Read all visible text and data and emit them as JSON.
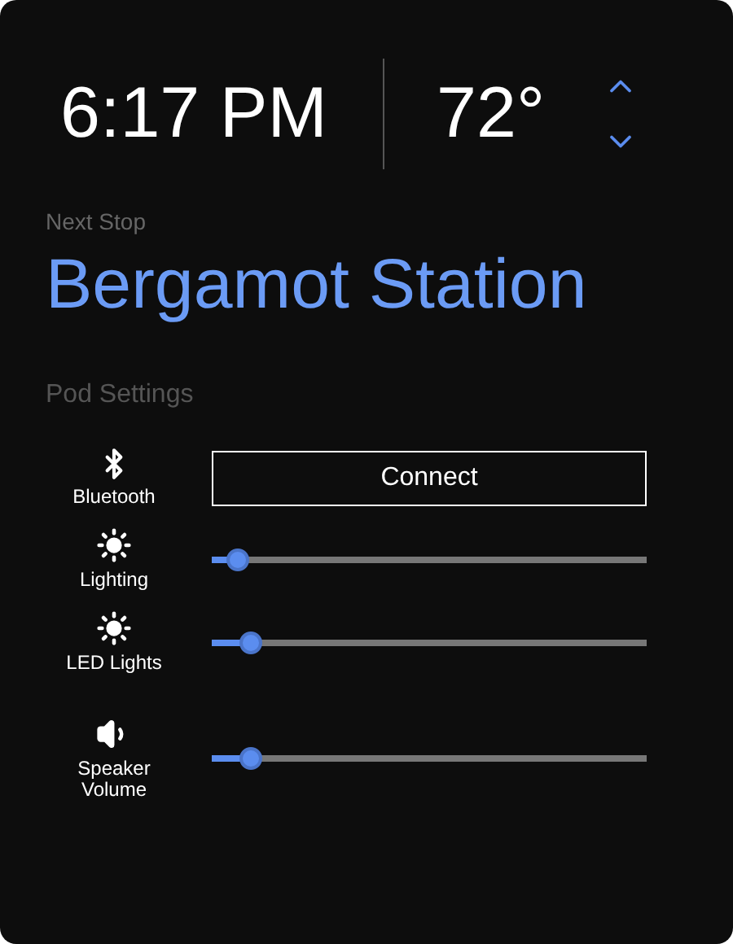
{
  "time": "6:17 PM",
  "temperature": "72°",
  "next_stop": {
    "label": "Next Stop",
    "name": "Bergamot Station"
  },
  "settings": {
    "title": "Pod Settings",
    "rows": [
      {
        "kind": "button",
        "label": "Bluetooth",
        "button": "Connect"
      },
      {
        "kind": "slider",
        "label": "Lighting",
        "level": 0.06
      },
      {
        "kind": "slider",
        "label": "LED Lights",
        "level": 0.09
      },
      {
        "kind": "slider",
        "label": "Speaker Volume",
        "level": 0.09
      }
    ]
  }
}
